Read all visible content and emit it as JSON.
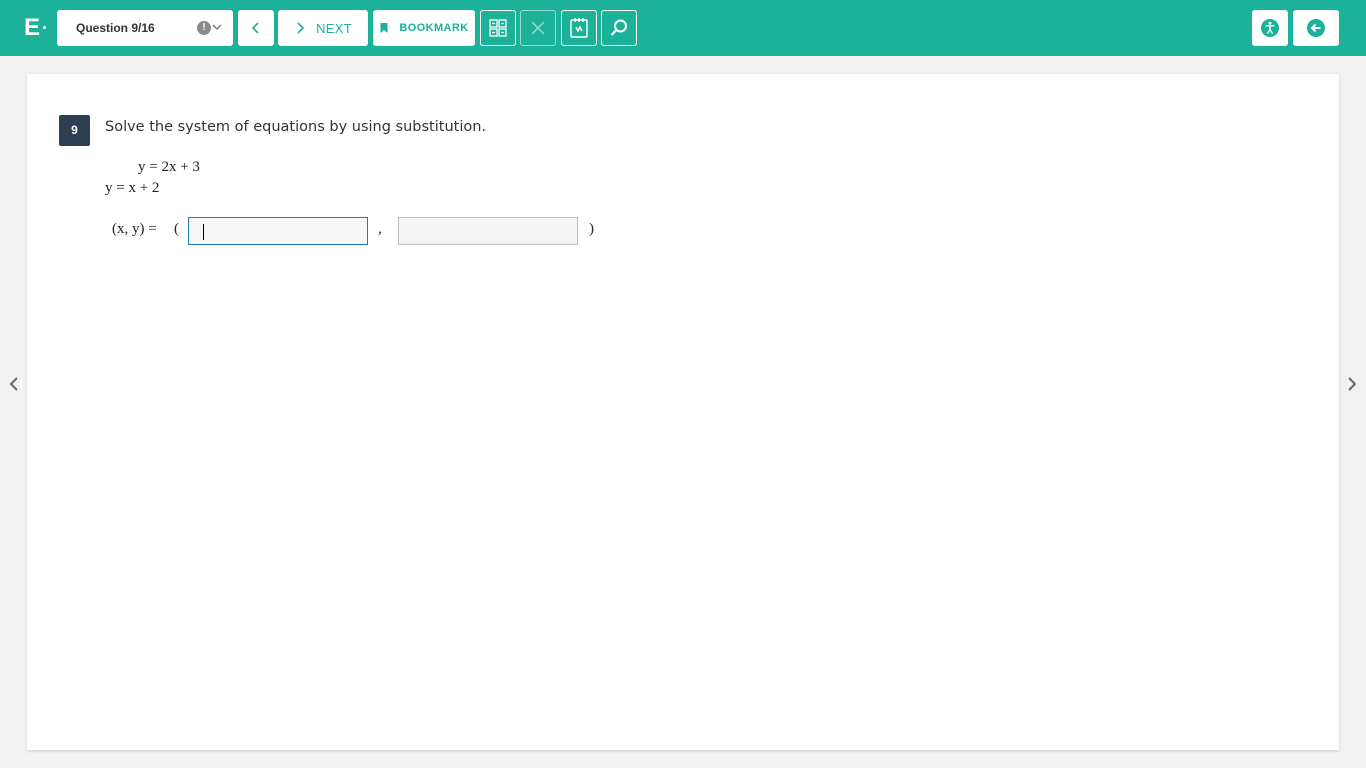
{
  "app": {
    "logo_letter": "E"
  },
  "toolbar": {
    "question_select": {
      "label": "Question 9/16",
      "alert_symbol": "!"
    },
    "prev_label": "<",
    "next_label": "NEXT",
    "bookmark_label": "BOOKMARK",
    "icons": [
      "grid-icon",
      "close-icon",
      "notepad-icon",
      "search-icon",
      "accessibility-icon",
      "exit-icon"
    ]
  },
  "question": {
    "number": "9",
    "prompt": "Solve the system of equations by using substitution.",
    "equations": [
      "y = 2x + 3",
      "y = x + 2"
    ],
    "answer_lhs": "(x, y) =",
    "open_paren": "(",
    "separator": ",",
    "close_paren": ")",
    "answer_x_value": "",
    "answer_y_value": ""
  },
  "colors": {
    "accent": "#1cb29a",
    "badge": "#2c3e50",
    "focus_border": "#1f7ab8"
  }
}
